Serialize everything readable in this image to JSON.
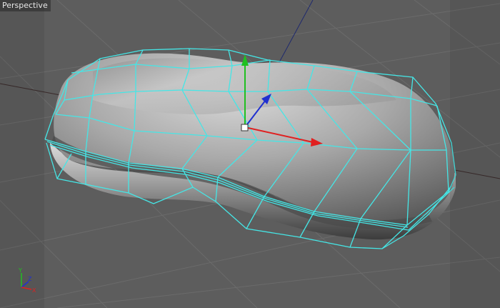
{
  "viewport": {
    "view_label": "Perspective"
  },
  "axis_indicator": {
    "y_label": "Y",
    "z_label": "Z",
    "x_label": "X"
  },
  "colors": {
    "background": "#5d5d5d",
    "grid_line": "#6a6a6a",
    "cage_wire": "#45e6e6",
    "x_axis": "#e02020",
    "y_axis": "#20c020",
    "z_axis": "#2030d0"
  },
  "object": {
    "shape": "rounded peanut-shaped subdivision surface",
    "cage": "cyan wireframe control cage"
  }
}
